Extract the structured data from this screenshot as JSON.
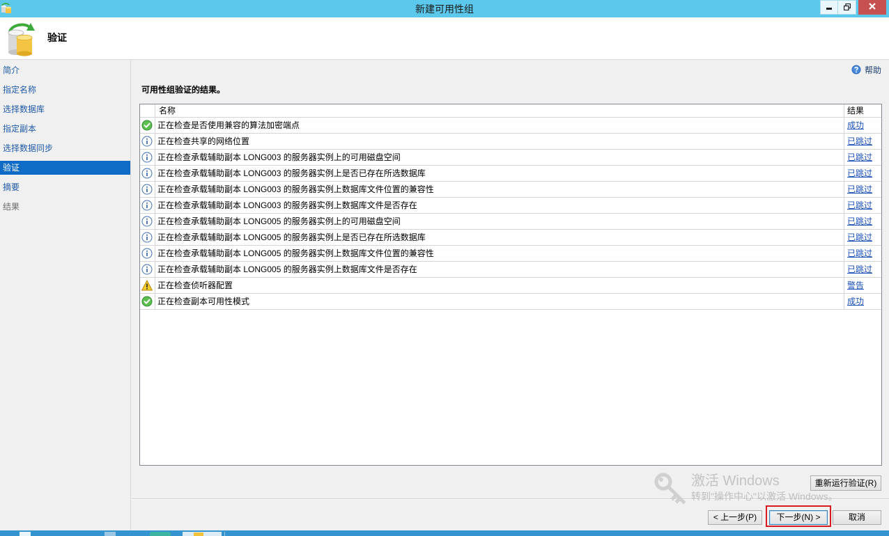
{
  "window": {
    "title": "新建可用性组",
    "icon": "database-app-icon"
  },
  "header": {
    "title": "验证",
    "icon": "availability-group-icon"
  },
  "sidebar": {
    "items": [
      {
        "label": "简介",
        "selected": false,
        "enabled": true
      },
      {
        "label": "指定名称",
        "selected": false,
        "enabled": true
      },
      {
        "label": "选择数据库",
        "selected": false,
        "enabled": true
      },
      {
        "label": "指定副本",
        "selected": false,
        "enabled": true
      },
      {
        "label": "选择数据同步",
        "selected": false,
        "enabled": true
      },
      {
        "label": "验证",
        "selected": true,
        "enabled": true
      },
      {
        "label": "摘要",
        "selected": false,
        "enabled": true
      },
      {
        "label": "结果",
        "selected": false,
        "enabled": false
      }
    ]
  },
  "main": {
    "help": {
      "label": "帮助",
      "icon": "help-icon"
    },
    "section_title": "可用性组验证的结果。",
    "table": {
      "columns": {
        "name": "名称",
        "result": "结果"
      },
      "rows": [
        {
          "icon": "success-icon",
          "name": "正在检查是否使用兼容的算法加密端点",
          "result": "成功"
        },
        {
          "icon": "info-icon",
          "name": "正在检查共享的网络位置",
          "result": "已跳过"
        },
        {
          "icon": "info-icon",
          "name": "正在检查承载辅助副本 LONG003 的服务器实例上的可用磁盘空间",
          "result": "已跳过"
        },
        {
          "icon": "info-icon",
          "name": "正在检查承载辅助副本 LONG003 的服务器实例上是否已存在所选数据库",
          "result": "已跳过"
        },
        {
          "icon": "info-icon",
          "name": "正在检查承载辅助副本 LONG003 的服务器实例上数据库文件位置的兼容性",
          "result": "已跳过"
        },
        {
          "icon": "info-icon",
          "name": "正在检查承载辅助副本 LONG003 的服务器实例上数据库文件是否存在",
          "result": "已跳过"
        },
        {
          "icon": "info-icon",
          "name": "正在检查承载辅助副本 LONG005 的服务器实例上的可用磁盘空间",
          "result": "已跳过"
        },
        {
          "icon": "info-icon",
          "name": "正在检查承载辅助副本 LONG005 的服务器实例上是否已存在所选数据库",
          "result": "已跳过"
        },
        {
          "icon": "info-icon",
          "name": "正在检查承载辅助副本 LONG005 的服务器实例上数据库文件位置的兼容性",
          "result": "已跳过"
        },
        {
          "icon": "info-icon",
          "name": "正在检查承载辅助副本 LONG005 的服务器实例上数据库文件是否存在",
          "result": "已跳过"
        },
        {
          "icon": "warning-icon",
          "name": "正在检查侦听器配置",
          "result": "警告"
        },
        {
          "icon": "success-icon",
          "name": "正在检查副本可用性模式",
          "result": "成功"
        }
      ]
    },
    "rerun_button": "重新运行验证(R)"
  },
  "footer": {
    "back": "< 上一步(P)",
    "next": "下一步(N) >",
    "cancel": "取消"
  },
  "watermark": {
    "title": "激活 Windows",
    "subtitle": "转到\"操作中心\"以激活 Windows。",
    "icon": "key-icon"
  },
  "colors": {
    "title_bar": "#5BC8EC",
    "selected_nav": "#0F6CC6",
    "nav_link": "#1F5BA9",
    "result_link": "#1A4FB8",
    "close_button": "#C75050",
    "highlight_box": "#D71920"
  }
}
